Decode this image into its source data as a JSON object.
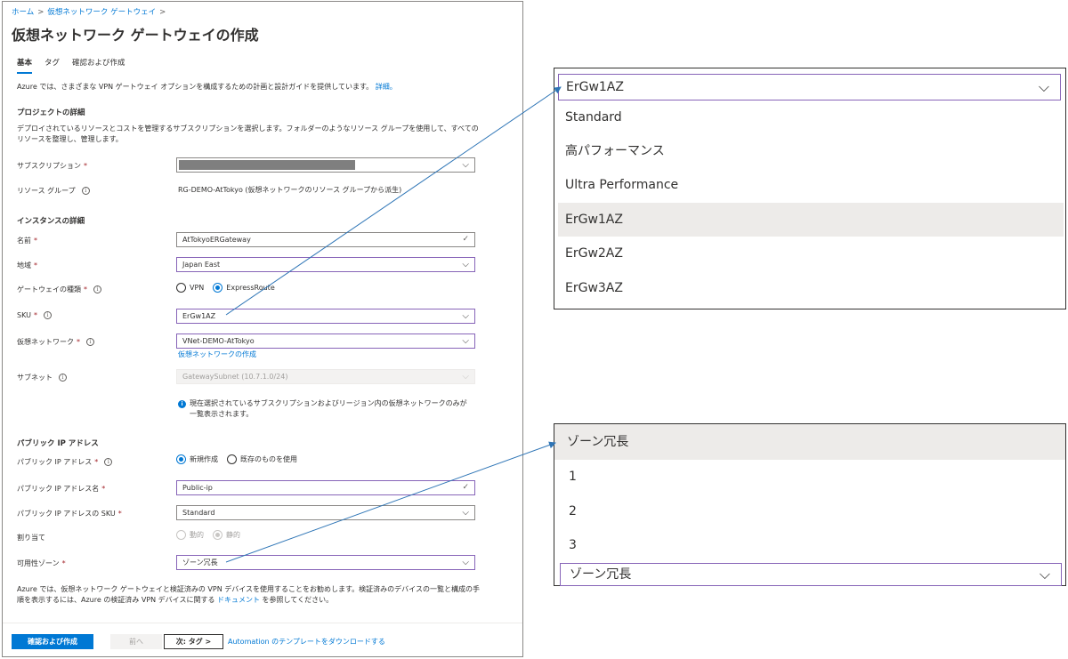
{
  "breadcrumb": {
    "home": "ホーム",
    "parent": "仮想ネットワーク ゲートウェイ",
    "sep": ">"
  },
  "page": {
    "title": "仮想ネットワーク ゲートウェイの作成",
    "more": "···"
  },
  "tabs": [
    {
      "label": "基本"
    },
    {
      "label": "タグ"
    },
    {
      "label": "確認および作成"
    }
  ],
  "intro": {
    "text": "Azure では、さまざまな VPN ゲートウェイ オプションを構成するための計画と設計ガイドを提供しています。",
    "link": "詳細。"
  },
  "project": {
    "heading": "プロジェクトの詳細",
    "desc": "デプロイされているリソースとコストを管理するサブスクリプションを選択します。フォルダーのようなリソース グループを使用して、すべてのリソースを整理し、管理します。",
    "subscription_label": "サブスクリプション",
    "resource_group_label": "リソース グループ",
    "resource_group_value": "RG-DEMO-AtTokyo (仮想ネットワークのリソース グループから派生)"
  },
  "instance": {
    "heading": "インスタンスの詳細",
    "name_label": "名前",
    "name_value": "AtTokyoERGateway",
    "region_label": "地域",
    "region_value": "Japan East",
    "gateway_type_label": "ゲートウェイの種類",
    "gateway_type_options": [
      "VPN",
      "ExpressRoute"
    ],
    "sku_label": "SKU",
    "sku_value": "ErGw1AZ",
    "vnet_label": "仮想ネットワーク",
    "vnet_value": "VNet-DEMO-AtTokyo",
    "vnet_create_link": "仮想ネットワークの作成",
    "subnet_label": "サブネット",
    "subnet_value": "GatewaySubnet (10.7.1.0/24)",
    "note": "現在選択されているサブスクリプションおよびリージョン内の仮想ネットワークのみが一覧表示されます。"
  },
  "publicip": {
    "heading": "パブリック IP アドレス",
    "ip_label": "パブリック IP アドレス",
    "ip_options": [
      "新規作成",
      "既存のものを使用"
    ],
    "name_label": "パブリック IP アドレス名",
    "name_value": "Public-ip",
    "sku_label": "パブリック IP アドレスの SKU",
    "sku_value": "Standard",
    "assign_label": "割り当て",
    "assign_options": [
      "動的",
      "静的"
    ],
    "zone_label": "可用性ゾーン",
    "zone_value": "ゾーン冗長"
  },
  "footnote": {
    "text": "Azure では、仮想ネットワーク ゲートウェイと検証済みの VPN デバイスを使用することをお勧めします。検証済みのデバイスの一覧と構成の手順を表示するには、Azure の検証済み VPN デバイスに関する",
    "link": "ドキュメント",
    "tail": "を参照してください。"
  },
  "footer": {
    "review": "確認および作成",
    "prev": "前へ",
    "next": "次: タグ >",
    "automation": "Automation のテンプレートをダウンロードする"
  },
  "sku_dropdown": {
    "selected": "ErGw1AZ",
    "options": [
      "Standard",
      "高パフォーマンス",
      "Ultra Performance",
      "ErGw1AZ",
      "ErGw2AZ",
      "ErGw3AZ"
    ]
  },
  "zone_dropdown": {
    "options": [
      "ゾーン冗長",
      "1",
      "2",
      "3"
    ],
    "selected": "ゾーン冗長"
  },
  "colors": {
    "accent": "#0078d4",
    "focus_border": "#8764b8",
    "required": "#a4262c",
    "arrow": "#2e75b6"
  }
}
